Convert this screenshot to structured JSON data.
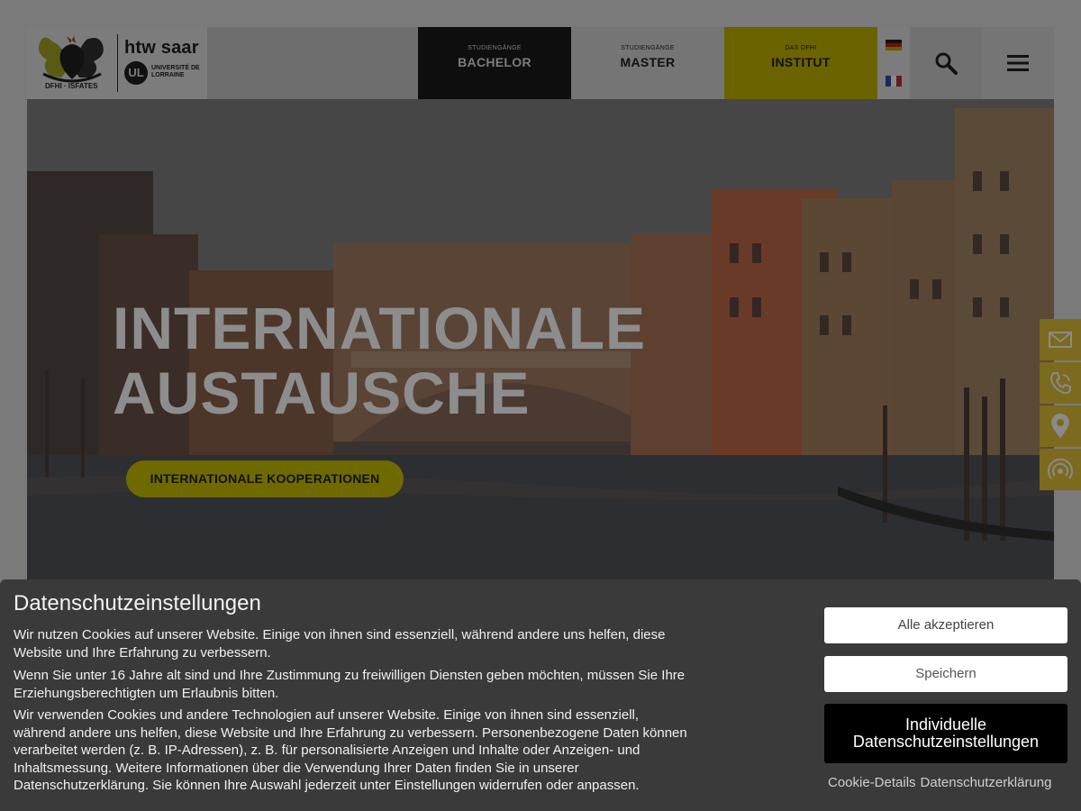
{
  "header": {
    "logo": {
      "left_caption": "DFHI · ISFATES",
      "right_title": "htw saar",
      "ul_mark": "UL",
      "ul_text": "UNIVERSITÉ DE LORRAINE"
    },
    "nav": [
      {
        "small": "STUDIENGÄNGE",
        "label": "BACHELOR"
      },
      {
        "small": "STUDIENGÄNGE",
        "label": "MASTER"
      },
      {
        "small": "DAS DFHI",
        "label": "INSTITUT"
      }
    ],
    "languages": [
      "de-flag-icon",
      "fr-flag-icon"
    ],
    "search_icon": "search-icon",
    "menu_icon": "hamburger-menu-icon"
  },
  "hero": {
    "title_line1": "INTERNATIONALE",
    "title_line2": "AUSTAUSCHE",
    "cta": "INTERNATIONALE KOOPERATIONEN"
  },
  "side_buttons": [
    "mail-icon",
    "phone-icon",
    "location-icon",
    "broadcast-icon"
  ],
  "cookie": {
    "title": "Datenschutzeinstellungen",
    "p1": "Wir nutzen Cookies auf unserer Website. Einige von ihnen sind essenziell, während andere uns helfen, diese Website und Ihre Erfahrung zu verbessern.",
    "p2": "Wenn Sie unter 16 Jahre alt sind und Ihre Zustimmung zu freiwilligen Diensten geben möchten, müssen Sie Ihre Erziehungsberechtigten um Erlaubnis bitten.",
    "p3": "Wir verwenden Cookies und andere Technologien auf unserer Website. Einige von ihnen sind essenziell, während andere uns helfen, diese Website und Ihre Erfahrung zu verbessern. Personenbezogene Daten können verarbeitet werden (z. B. IP-Adressen), z. B. für personalisierte Anzeigen und Inhalte oder Anzeigen- und Inhaltsmessung. Weitere Informationen über die Verwendung Ihrer Daten finden Sie in unserer Datenschutzerklärung. Sie können Ihre Auswahl jederzeit unter Einstellungen widerrufen oder anpassen.",
    "accept_all": "Alle akzeptieren",
    "save": "Speichern",
    "individual_line1": "Individuelle",
    "individual_line2": "Datenschutzeinstellungen",
    "link_details": "Cookie-Details",
    "link_privacy": "Datenschutzerklärung"
  },
  "colors": {
    "accent_yellow": "#e6d600",
    "dark": "#0e0e0e",
    "cookie_bg": "#3a3a3a"
  }
}
